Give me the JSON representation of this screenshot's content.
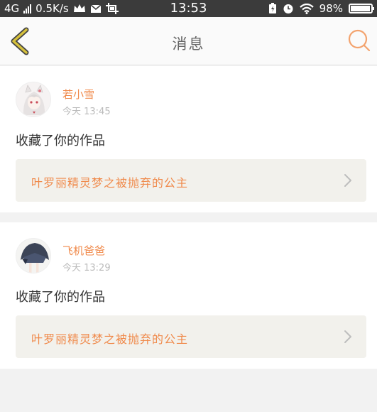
{
  "status_bar": {
    "network": "4G",
    "speed": "0.5K/s",
    "time": "13:53",
    "battery": "98%",
    "battery_level": 0.98,
    "icons": [
      "signal-icon",
      "crown-icon",
      "mail-icon",
      "screenshot-icon",
      "battery-saver-icon",
      "alarm-icon",
      "wifi-icon",
      "battery-icon"
    ]
  },
  "header": {
    "title": "消息",
    "back_icon": "chevron-left-icon",
    "search_icon": "search-icon"
  },
  "messages": [
    {
      "username": "若小雪",
      "time": "今天 13:45",
      "action": "收藏了你的作品",
      "work_title": "叶罗丽精灵梦之被抛弃的公主"
    },
    {
      "username": "飞机爸爸",
      "time": "今天 13:29",
      "action": "收藏了你的作品",
      "work_title": "叶罗丽精灵梦之被抛弃的公主"
    }
  ],
  "colors": {
    "accent": "#f08a4b",
    "back_icon": "#d6c13c",
    "status_bar": "#3b3b3b",
    "card_link_bg": "#f2f1ec"
  }
}
